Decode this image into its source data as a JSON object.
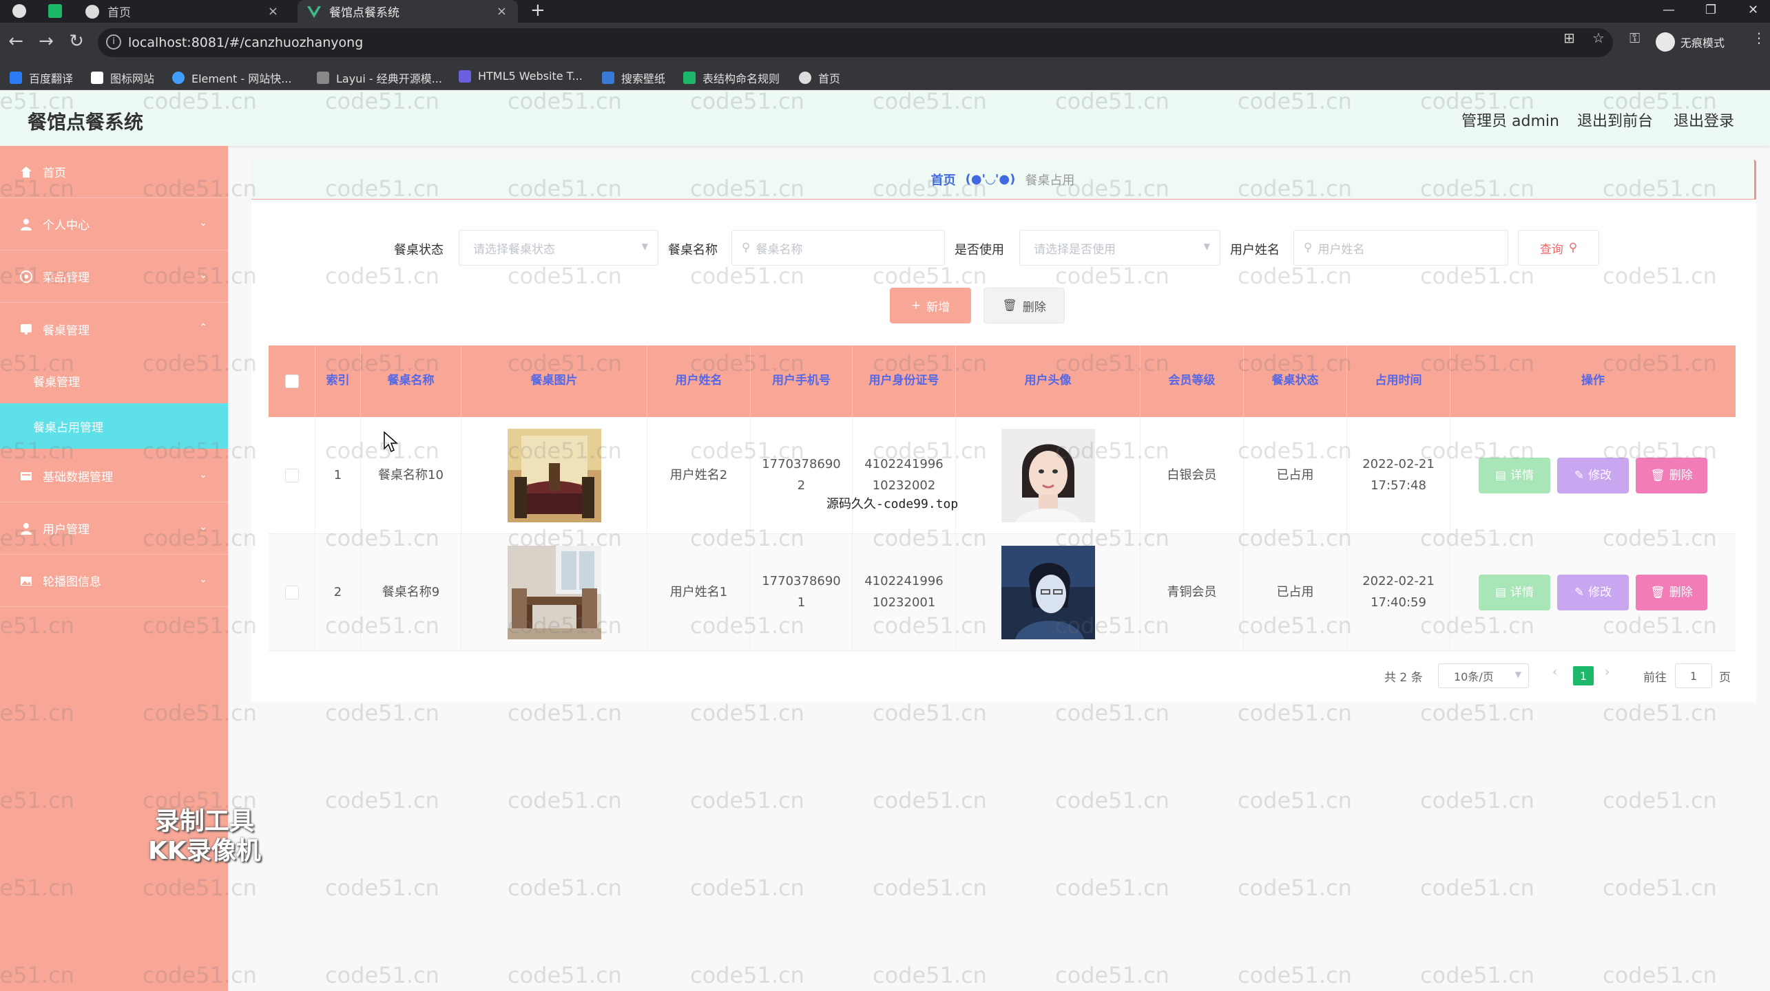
{
  "browser": {
    "tabs": [
      {
        "label": "首页",
        "active": false
      },
      {
        "label": "餐馆点餐系统",
        "active": true
      }
    ],
    "new_tab": "+",
    "url": "localhost:8081/#/canzhuozhanyong",
    "profile_label": "无痕模式",
    "bookmarks": [
      "百度翻译",
      "图标网站",
      "Element - 网站快...",
      "Layui - 经典开源模...",
      "HTML5 Website T...",
      "搜索壁纸",
      "表结构命名规则",
      "首页"
    ]
  },
  "header": {
    "title": "餐馆点餐系统",
    "admin_label": "管理员 admin",
    "to_front_label": "退出到前台",
    "logout_label": "退出登录"
  },
  "sidebar": {
    "items": [
      {
        "label": "首页",
        "icon": "home-icon",
        "expandable": false
      },
      {
        "label": "个人中心",
        "icon": "user-icon",
        "expandable": true
      },
      {
        "label": "菜品管理",
        "icon": "dish-icon",
        "expandable": true
      },
      {
        "label": "餐桌管理",
        "icon": "table-icon",
        "expandable": true,
        "expanded": true
      },
      {
        "label": "基础数据管理",
        "icon": "database-icon",
        "expandable": true
      },
      {
        "label": "用户管理",
        "icon": "user-icon",
        "expandable": true
      },
      {
        "label": "轮播图信息",
        "icon": "image-icon",
        "expandable": true
      }
    ],
    "subitems": [
      {
        "label": "餐桌管理",
        "active": false
      },
      {
        "label": "餐桌占用管理",
        "active": true
      }
    ]
  },
  "breadcrumb": {
    "home": "首页",
    "face": "(●'◡'●)",
    "current": "餐桌占用"
  },
  "filters": {
    "status_label": "餐桌状态",
    "status_placeholder": "请选择餐桌状态",
    "name_label": "餐桌名称",
    "name_placeholder": "餐桌名称",
    "inuse_label": "是否使用",
    "inuse_placeholder": "请选择是否使用",
    "username_label": "用户姓名",
    "username_placeholder": "用户姓名",
    "query_label": "查询"
  },
  "actions": {
    "add_label": "新增",
    "delete_label": "删除"
  },
  "table": {
    "columns": [
      "索引",
      "餐桌名称",
      "餐桌图片",
      "用户姓名",
      "用户手机号",
      "用户身份证号",
      "用户头像",
      "会员等级",
      "餐桌状态",
      "占用时间",
      "操作"
    ],
    "rows": [
      {
        "index": "1",
        "table_name": "餐桌名称10",
        "user_name": "用户姓名2",
        "phone_1": "1770378690",
        "phone_2": "2",
        "id_1": "4102241996",
        "id_2": "10232002",
        "level": "白银会员",
        "status": "已占用",
        "date": "2022-02-21",
        "time": "17:57:48"
      },
      {
        "index": "2",
        "table_name": "餐桌名称9",
        "user_name": "用户姓名1",
        "phone_1": "1770378690",
        "phone_2": "1",
        "id_1": "4102241996",
        "id_2": "10232001",
        "level": "青铜会员",
        "status": "已占用",
        "date": "2022-02-21",
        "time": "17:40:59"
      }
    ],
    "row_actions": {
      "detail": "详情",
      "edit": "修改",
      "delete": "删除"
    }
  },
  "pagination": {
    "total": "共 2 条",
    "page_size": "10条/页",
    "current_page": "1",
    "goto_label": "前往",
    "goto_value": "1",
    "page_unit": "页"
  },
  "overlay": {
    "source_text": "源码久久-code99.top",
    "recorder_line1": "录制工具",
    "recorder_line2": "KK录像机",
    "watermark": "code51.cn"
  },
  "colors": {
    "sidebar": "#f8a696",
    "table_header": "#f8a696",
    "active_submenu": "#5ee0e8",
    "header_bg": "#edf9f3",
    "detail_btn": "#a8e6b8",
    "edit_btn": "#c9a6f0",
    "delete_btn": "#f27cb8",
    "pager_active": "#1eb86a"
  }
}
